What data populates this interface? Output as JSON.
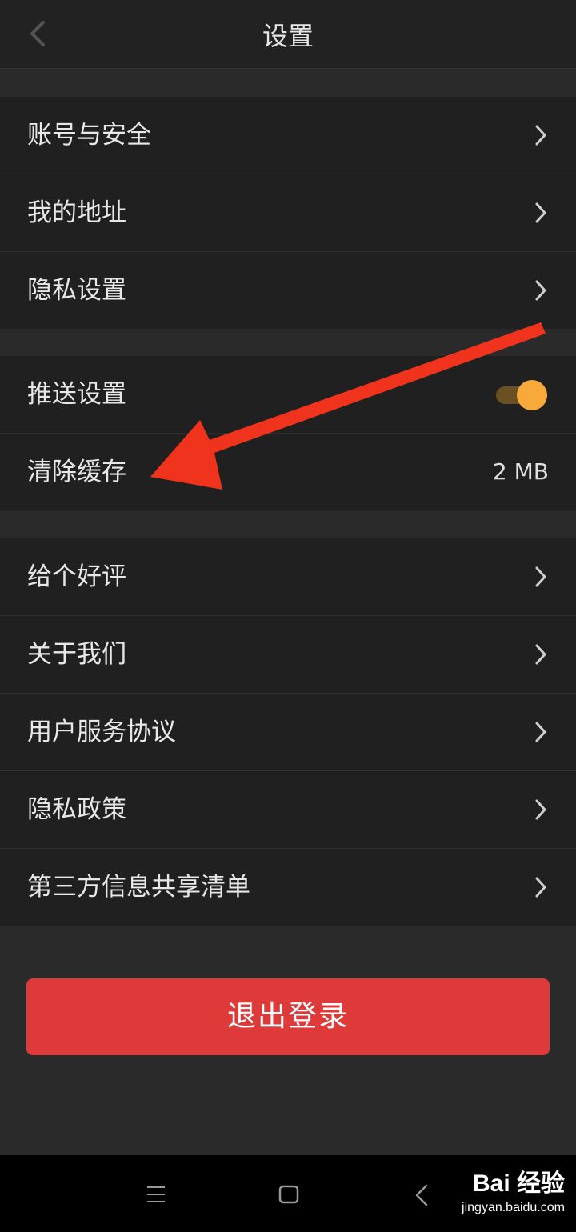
{
  "header": {
    "title": "设置",
    "back_icon": "chevron-left-icon"
  },
  "groups": [
    {
      "rows": [
        {
          "label": "账号与安全",
          "type": "link"
        },
        {
          "label": "我的地址",
          "type": "link"
        },
        {
          "label": "隐私设置",
          "type": "link"
        }
      ]
    },
    {
      "rows": [
        {
          "label": "推送设置",
          "type": "toggle",
          "on": true
        },
        {
          "label": "清除缓存",
          "type": "value",
          "value": "2 MB"
        }
      ]
    },
    {
      "rows": [
        {
          "label": "给个好评",
          "type": "link"
        },
        {
          "label": "关于我们",
          "type": "link"
        },
        {
          "label": "用户服务协议",
          "type": "link"
        },
        {
          "label": "隐私政策",
          "type": "link"
        },
        {
          "label": "第三方信息共享清单",
          "type": "link"
        }
      ]
    }
  ],
  "logout_label": "退出登录",
  "colors": {
    "background": "#2a2a2a",
    "row_background": "#202020",
    "accent_toggle": "#f7a93a",
    "logout_button": "#de3a3a",
    "annotation_arrow": "#f0331c"
  },
  "navbar": {
    "icons": [
      "menu-icon",
      "home-square-icon",
      "back-triangle-icon"
    ]
  },
  "watermark": {
    "brand": "Bai 经验",
    "url": "jingyan.baidu.com"
  }
}
